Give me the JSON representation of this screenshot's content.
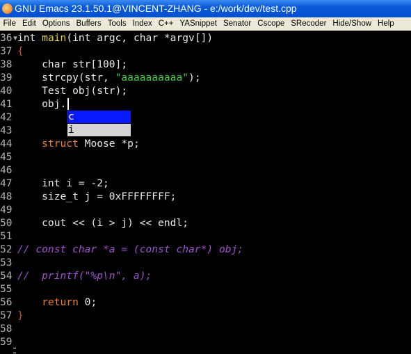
{
  "window": {
    "title": "GNU Emacs 23.1.50.1@VINCENT-ZHANG - e:/work/dev/test.cpp"
  },
  "menu": [
    "File",
    "Edit",
    "Options",
    "Buffers",
    "Tools",
    "Index",
    "C++",
    "YASnippet",
    "Senator",
    "Cscope",
    "SRecoder",
    "Hide/Show",
    "Help"
  ],
  "colors": {
    "function": "#e8d030",
    "keyword": "#f08030",
    "string": "#40d040",
    "comment": "#a050d0",
    "selection": "#0a1aff"
  },
  "lines": [
    {
      "n": "36▾",
      "t": [
        [
          "tx",
          "int "
        ],
        [
          "fn",
          "main"
        ],
        [
          "tx",
          "(int argc, char *argv[])"
        ]
      ]
    },
    {
      "n": "37",
      "t": [
        [
          "br",
          "{"
        ]
      ]
    },
    {
      "n": "38",
      "t": [
        [
          "tx",
          "    char str[100];"
        ]
      ]
    },
    {
      "n": "39",
      "t": [
        [
          "tx",
          "    strcpy(str, "
        ],
        [
          "str",
          "\"aaaaaaaaaa\""
        ],
        [
          "tx",
          ");"
        ]
      ]
    },
    {
      "n": "40",
      "t": [
        [
          "tx",
          "    Test obj(str);"
        ]
      ]
    },
    {
      "n": "41",
      "t": [
        [
          "tx",
          "    obj."
        ]
      ]
    },
    {
      "n": "42",
      "t": []
    },
    {
      "n": "43",
      "t": []
    },
    {
      "n": "44",
      "t": [
        [
          "kw",
          "    struct"
        ],
        [
          "tx",
          " Moose *p;"
        ]
      ]
    },
    {
      "n": "45",
      "t": []
    },
    {
      "n": "46",
      "t": []
    },
    {
      "n": "47",
      "t": [
        [
          "tx",
          "    int i = -2;"
        ]
      ]
    },
    {
      "n": "48",
      "t": [
        [
          "tx",
          "    size_t j = 0xFFFFFFFF;"
        ]
      ]
    },
    {
      "n": "49",
      "t": []
    },
    {
      "n": "50",
      "t": [
        [
          "tx",
          "    cout << (i > j) << endl;"
        ]
      ]
    },
    {
      "n": "51",
      "t": []
    },
    {
      "n": "52",
      "t": [
        [
          "cm",
          "// const char *a = (const char*) obj;"
        ]
      ]
    },
    {
      "n": "53",
      "t": []
    },
    {
      "n": "54",
      "t": [
        [
          "cm",
          "//  printf(\"%p\\n\", a);"
        ]
      ]
    },
    {
      "n": "55",
      "t": []
    },
    {
      "n": "56",
      "t": [
        [
          "kw",
          "    return"
        ],
        [
          "tx",
          " 0;"
        ]
      ]
    },
    {
      "n": "57",
      "t": [
        [
          "br",
          "}"
        ]
      ]
    },
    {
      "n": "58",
      "t": []
    },
    {
      "n": "59",
      "t": []
    }
  ],
  "completion": {
    "items": [
      "c",
      "i"
    ],
    "selected": "c"
  }
}
